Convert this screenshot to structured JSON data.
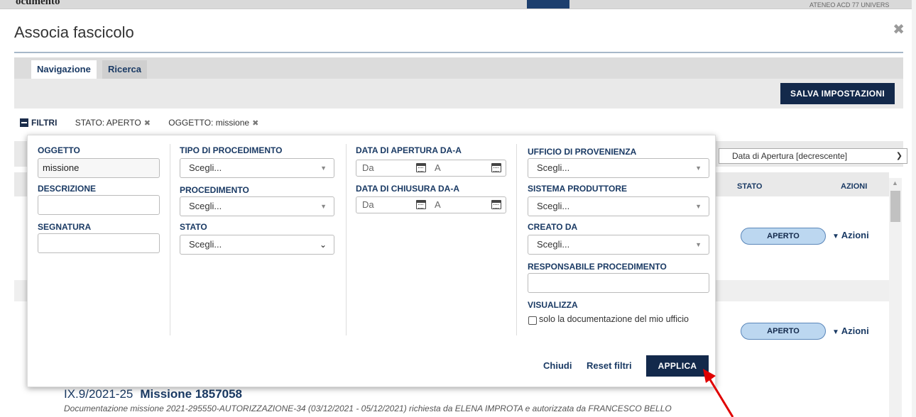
{
  "background": {
    "header_fragment": "ocumento",
    "header_right_fragment": "ATENEO ACD 77 UNIVERS"
  },
  "dialog": {
    "title": "Associa fascicolo",
    "close_icon": "close-icon"
  },
  "tabs": [
    {
      "label": "Navigazione",
      "active": true
    },
    {
      "label": "Ricerca",
      "active": false
    }
  ],
  "toolbar": {
    "save_label": "SALVA IMPOSTAZIONI"
  },
  "filters_bar": {
    "toggle_label": "FILTRI",
    "chips": [
      {
        "label": "STATO: APERTO"
      },
      {
        "label": "OGGETTO: missione"
      }
    ]
  },
  "sort": {
    "selected": "Data di Apertura [decrescente]"
  },
  "table": {
    "headers": {
      "stato": "STATO",
      "azioni": "AZIONI"
    },
    "rows": [
      {
        "status": "APERTO",
        "actions": "Azioni"
      },
      {
        "status": "APERTO",
        "actions": "Azioni"
      },
      {
        "segnatura": "IX.9/2021-25",
        "title": "Missione 1857058",
        "description": "Documentazione missione 2021-295550-AUTORIZZAZIONE-34 (03/12/2021 - 05/12/2021) richiesta da ELENA IMPROTA e autorizzata da FRANCESCO BELLO"
      }
    ]
  },
  "filter_panel": {
    "oggetto": {
      "label": "OGGETTO",
      "value": "missione"
    },
    "descrizione": {
      "label": "DESCRIZIONE",
      "value": ""
    },
    "segnatura": {
      "label": "SEGNATURA",
      "value": ""
    },
    "tipo_procedimento": {
      "label": "TIPO DI PROCEDIMENTO",
      "value": "Scegli..."
    },
    "procedimento": {
      "label": "PROCEDIMENTO",
      "value": "Scegli..."
    },
    "stato": {
      "label": "STATO",
      "value": "Scegli..."
    },
    "data_apertura": {
      "label": "DATA DI APERTURA DA-A",
      "from_placeholder": "Da",
      "to_placeholder": "A"
    },
    "data_chiusura": {
      "label": "DATA DI CHIUSURA DA-A",
      "from_placeholder": "Da",
      "to_placeholder": "A"
    },
    "ufficio_provenienza": {
      "label": "UFFICIO DI PROVENIENZA",
      "value": "Scegli..."
    },
    "sistema_produttore": {
      "label": "SISTEMA PRODUTTORE",
      "value": "Scegli..."
    },
    "creato_da": {
      "label": "CREATO DA",
      "value": "Scegli..."
    },
    "responsabile": {
      "label": "RESPONSABILE PROCEDIMENTO",
      "value": ""
    },
    "visualizza": {
      "label": "VISUALIZZA",
      "checkbox_label": "solo la documentazione del mio ufficio",
      "checked": false
    },
    "buttons": {
      "close": "Chiudi",
      "reset": "Reset filtri",
      "apply": "APPLICA"
    }
  },
  "colors": {
    "navy": "#13294b",
    "link": "#1a3a64",
    "badge_fill": "#bcd7f0",
    "arrow": "#e00000"
  }
}
